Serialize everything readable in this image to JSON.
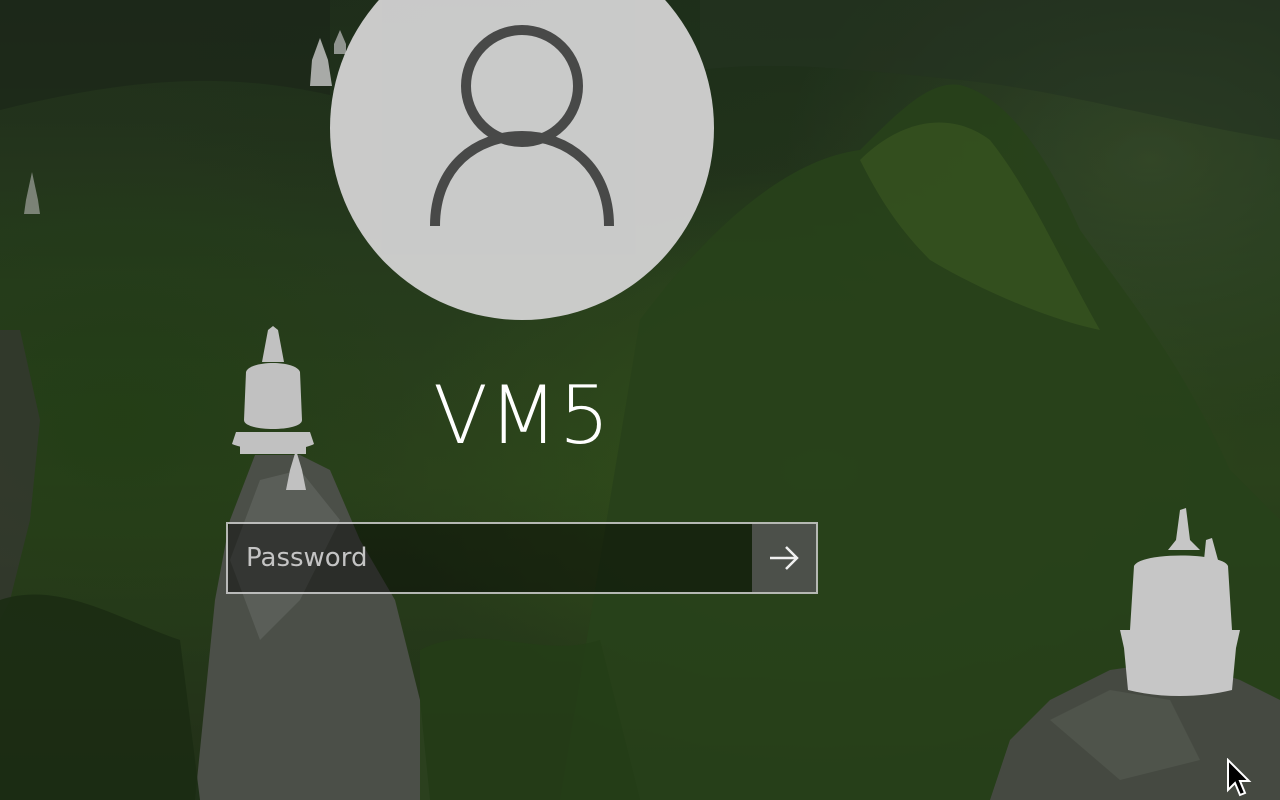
{
  "user": {
    "name": "VM5",
    "avatar_icon": "user-silhouette-icon"
  },
  "password": {
    "placeholder": "Password",
    "value": "",
    "submit_icon": "arrow-right-icon"
  },
  "background": {
    "description_icon": "wallpaper-image",
    "accent_dark": "#26361c",
    "accent_green": "#3c5f1e"
  },
  "colors": {
    "avatar_bg": "#cfcfcf",
    "avatar_glyph": "#4a4a4a",
    "text": "#ffffff",
    "input_border": "#e1e1e1",
    "submit_bg": "#5f5f5f"
  }
}
